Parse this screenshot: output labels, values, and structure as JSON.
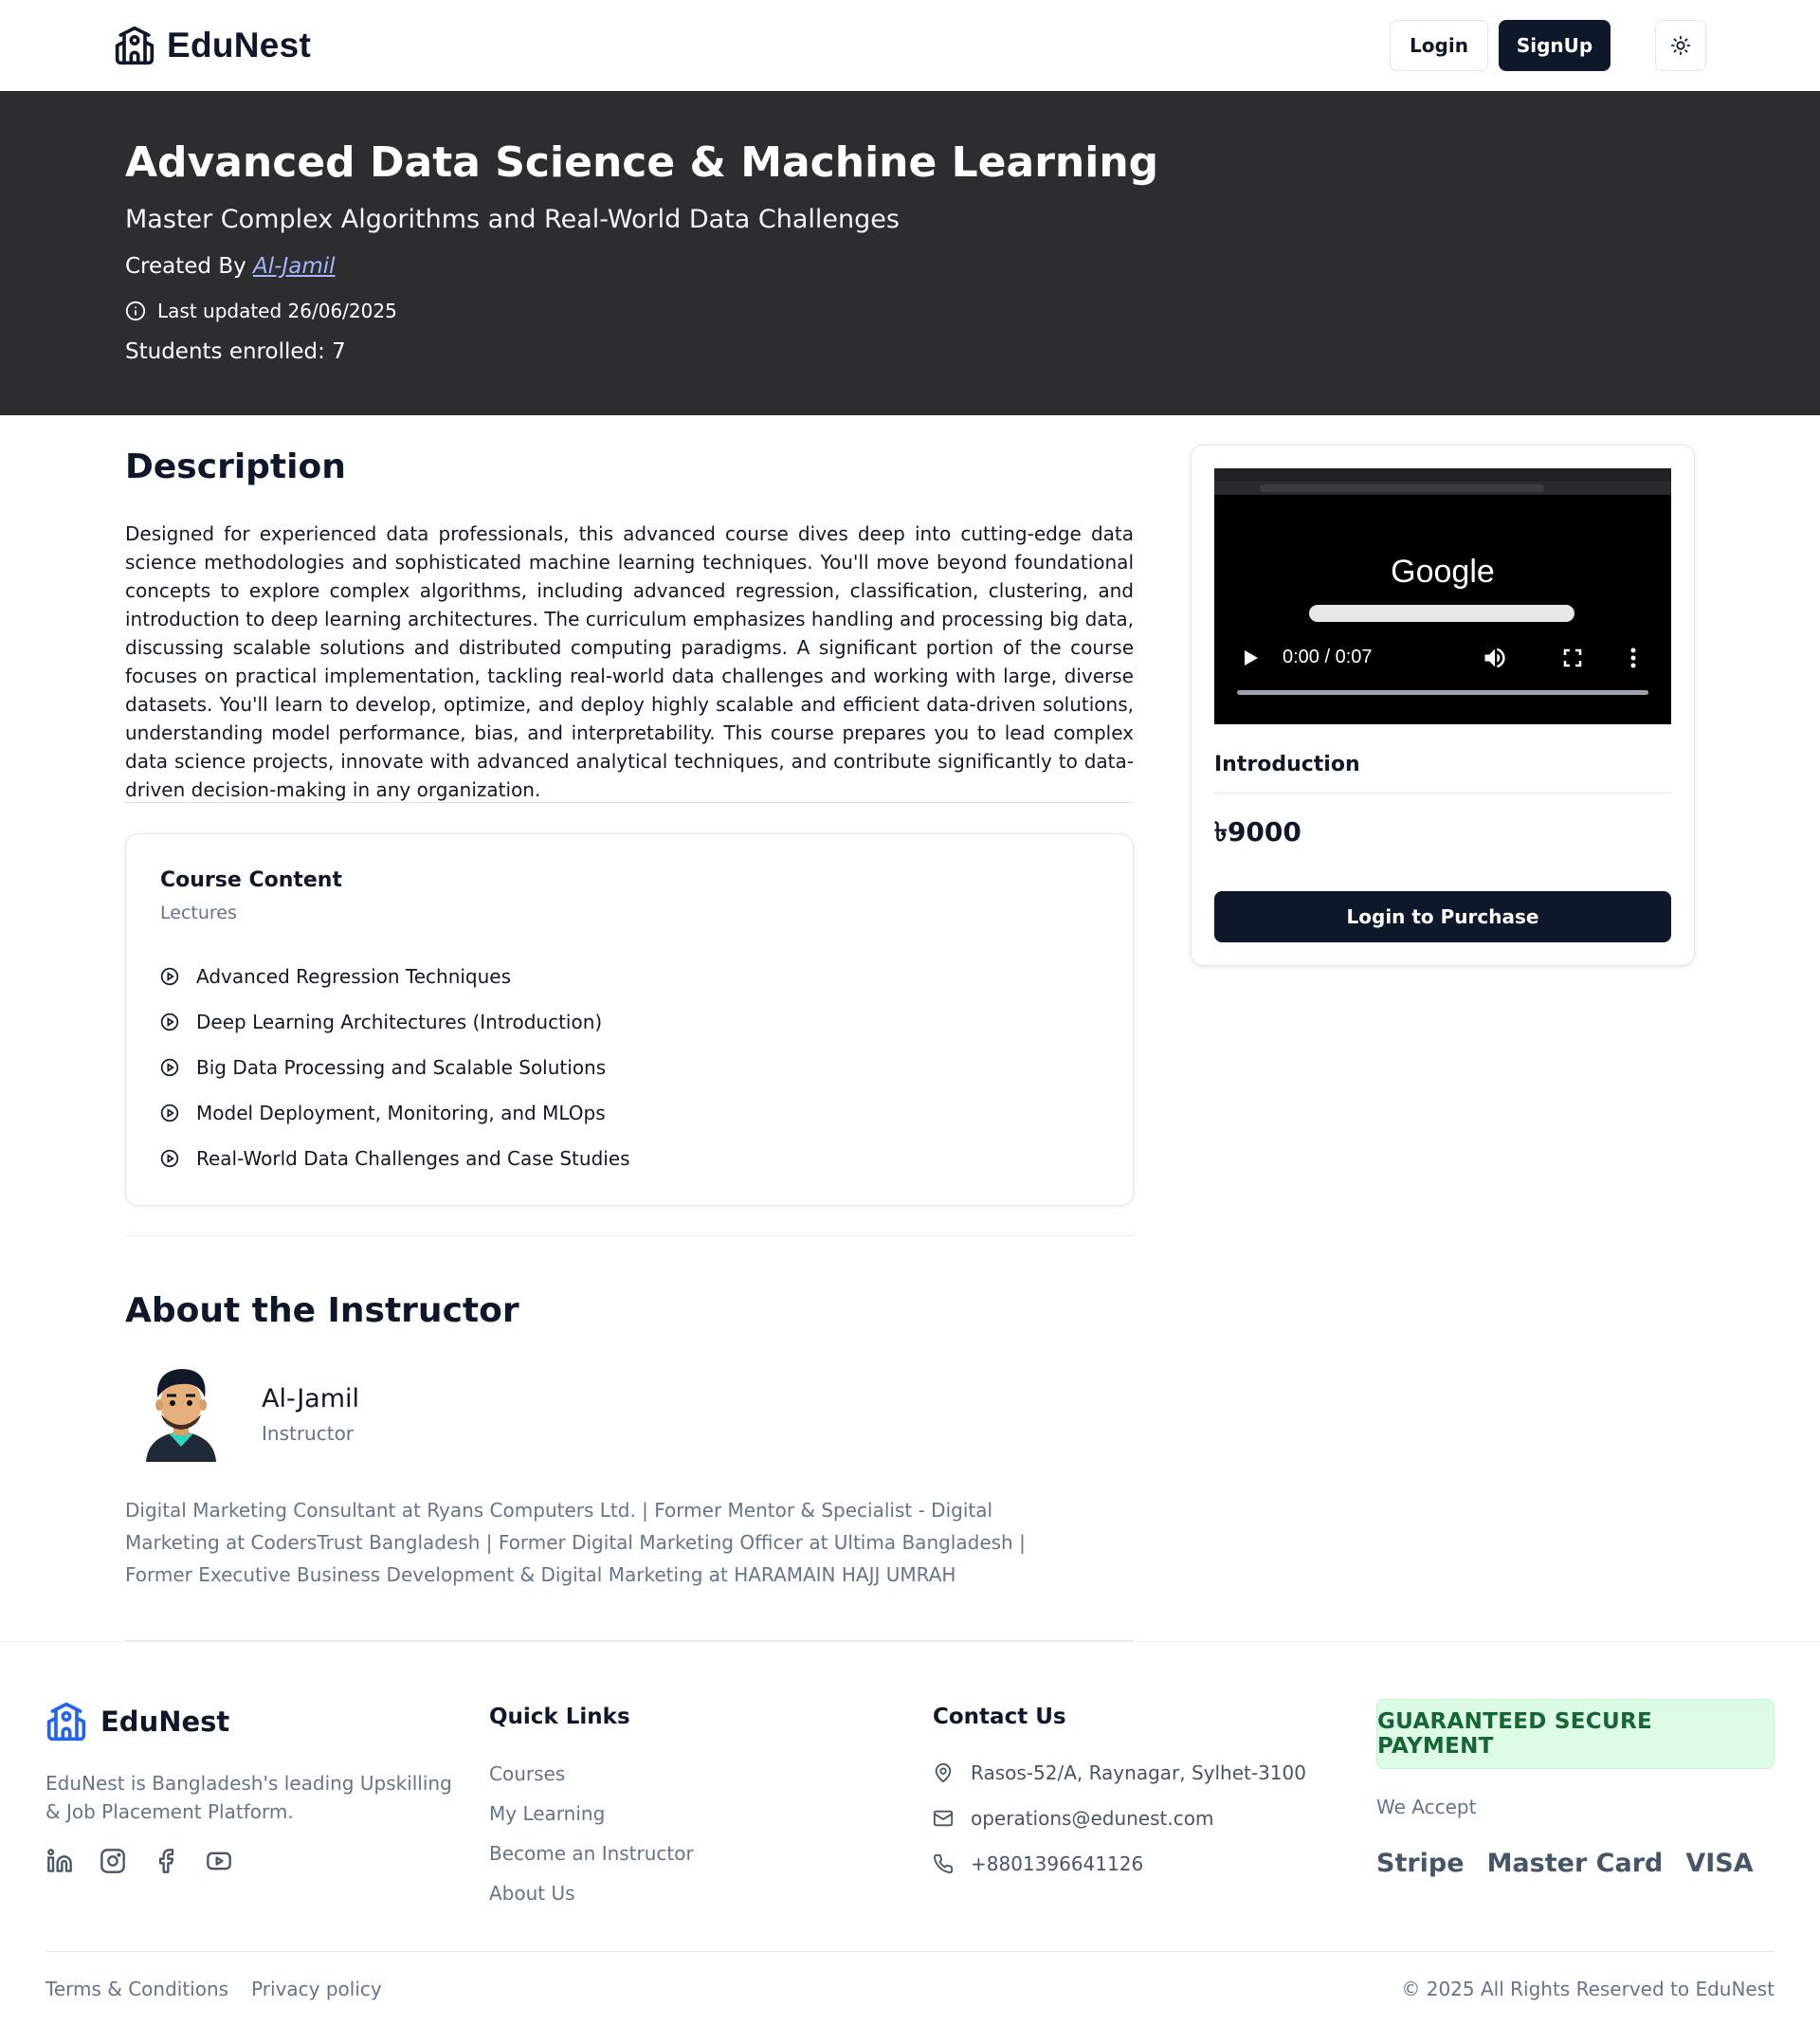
{
  "header": {
    "brand": "EduNest",
    "login_label": "Login",
    "signup_label": "SignUp",
    "theme_icon": "sun-icon"
  },
  "hero": {
    "title": "Advanced Data Science & Machine Learning",
    "subtitle": "Master Complex Algorithms and Real-World Data Challenges",
    "created_prefix": "Created By",
    "author": "Al-Jamil",
    "last_updated": "Last updated 26/06/2025",
    "students_enrolled": "Students enrolled: 7"
  },
  "description": {
    "title": "Description",
    "text": "Designed for experienced data professionals, this advanced course dives deep into cutting-edge data science methodologies and sophisticated machine learning techniques. You'll move beyond foundational concepts to explore complex algorithms, including advanced regression, classification, clustering, and introduction to deep learning architectures. The curriculum emphasizes handling and processing big data, discussing scalable solutions and distributed computing paradigms. A significant portion of the course focuses on practical implementation, tackling real-world data challenges and working with large, diverse datasets. You'll learn to develop, optimize, and deploy highly scalable and efficient data-driven solutions, understanding model performance, bias, and interpretability. This course prepares you to lead complex data science projects, innovate with advanced analytical techniques, and contribute significantly to data-driven decision-making in any organization."
  },
  "course_content": {
    "title": "Course Content",
    "subtitle": "Lectures",
    "lectures": [
      "Advanced Regression Techniques",
      "Deep Learning Architectures (Introduction)",
      "Big Data Processing and Scalable Solutions",
      "Model Deployment, Monitoring, and MLOps",
      "Real-World Data Challenges and Case Studies"
    ]
  },
  "instructor": {
    "section_title": "About the Instructor",
    "name": "Al-Jamil",
    "role": "Instructor",
    "bio": "Digital Marketing Consultant at Ryans Computers Ltd. | Former Mentor & Specialist - Digital Marketing at CodersTrust Bangladesh | Former Digital Marketing Officer at Ultima Bangladesh | Former Executive Business Development & Digital Marketing at HARAMAIN HAJJ UMRAH"
  },
  "sidebar": {
    "video": {
      "time": "0:00 / 0:07",
      "screen_text": "Google",
      "progress": 0
    },
    "intro_label": "Introduction",
    "price": "৳9000",
    "purchase_label": "Login to Purchase"
  },
  "footer": {
    "brand": "EduNest",
    "about": "EduNest is Bangladesh's leading Upskilling & Job Placement Platform.",
    "social_icons": [
      "linkedin-icon",
      "instagram-icon",
      "facebook-icon",
      "youtube-icon"
    ],
    "quick_links_title": "Quick Links",
    "quick_links": [
      "Courses",
      "My Learning",
      "Become an Instructor",
      "About Us"
    ],
    "contact_title": "Contact Us",
    "contact": {
      "address": "Rasos-52/A, Raynagar, Sylhet-3100",
      "email": "operations@edunest.com",
      "phone": "+8801396641126"
    },
    "secure_label": "GUARANTEED SECURE PAYMENT",
    "we_accept": "We Accept",
    "payment_methods": [
      "Stripe",
      "Master Card",
      "VISA"
    ],
    "terms": "Terms & Conditions",
    "privacy": "Privacy policy",
    "copyright": "© 2025 All Rights Reserved to EduNest"
  },
  "colors": {
    "primary_dark": "#0f172a",
    "hero_bg": "#2d2d2f",
    "author_link": "#a5b4fc",
    "secure_bg": "#dcfce7",
    "secure_text": "#166534",
    "brand_blue": "#2563eb"
  }
}
